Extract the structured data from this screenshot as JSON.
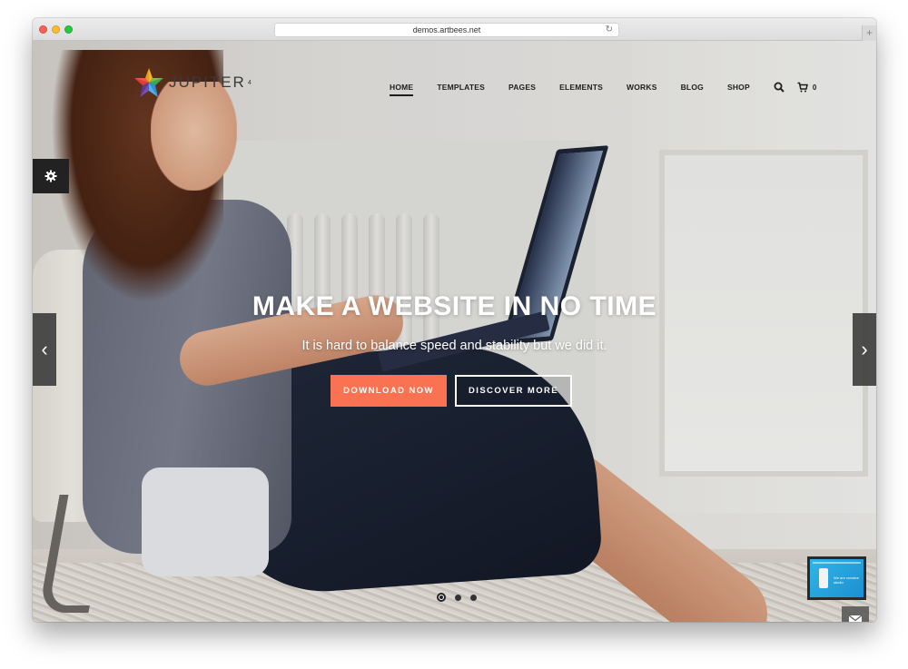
{
  "browser": {
    "url": "demos.artbees.net",
    "reload_icon": "reload-icon",
    "new_tab_icon": "plus-icon",
    "new_tab_glyph": "+"
  },
  "header": {
    "logo_text": "JUPITER",
    "logo_version": "4",
    "nav": [
      {
        "label": "HOME",
        "active": true
      },
      {
        "label": "TEMPLATES",
        "active": false
      },
      {
        "label": "PAGES",
        "active": false
      },
      {
        "label": "ELEMENTS",
        "active": false
      },
      {
        "label": "WORKS",
        "active": false
      },
      {
        "label": "BLOG",
        "active": false
      },
      {
        "label": "SHOP",
        "active": false
      }
    ],
    "cart_count": "0"
  },
  "hero": {
    "title": "MAKE A WEBSITE IN NO TIME",
    "subtitle": "It is hard to balance speed and stability but we did it.",
    "primary_button": "DOWNLOAD NOW",
    "secondary_button": "DISCOVER MORE",
    "primary_color": "#f97352",
    "slides_total": 3,
    "active_slide": 1
  },
  "preview_widget": {
    "text": "We are creative studio"
  },
  "icons": {
    "prev": "‹",
    "next": "›",
    "reload": "↻"
  }
}
